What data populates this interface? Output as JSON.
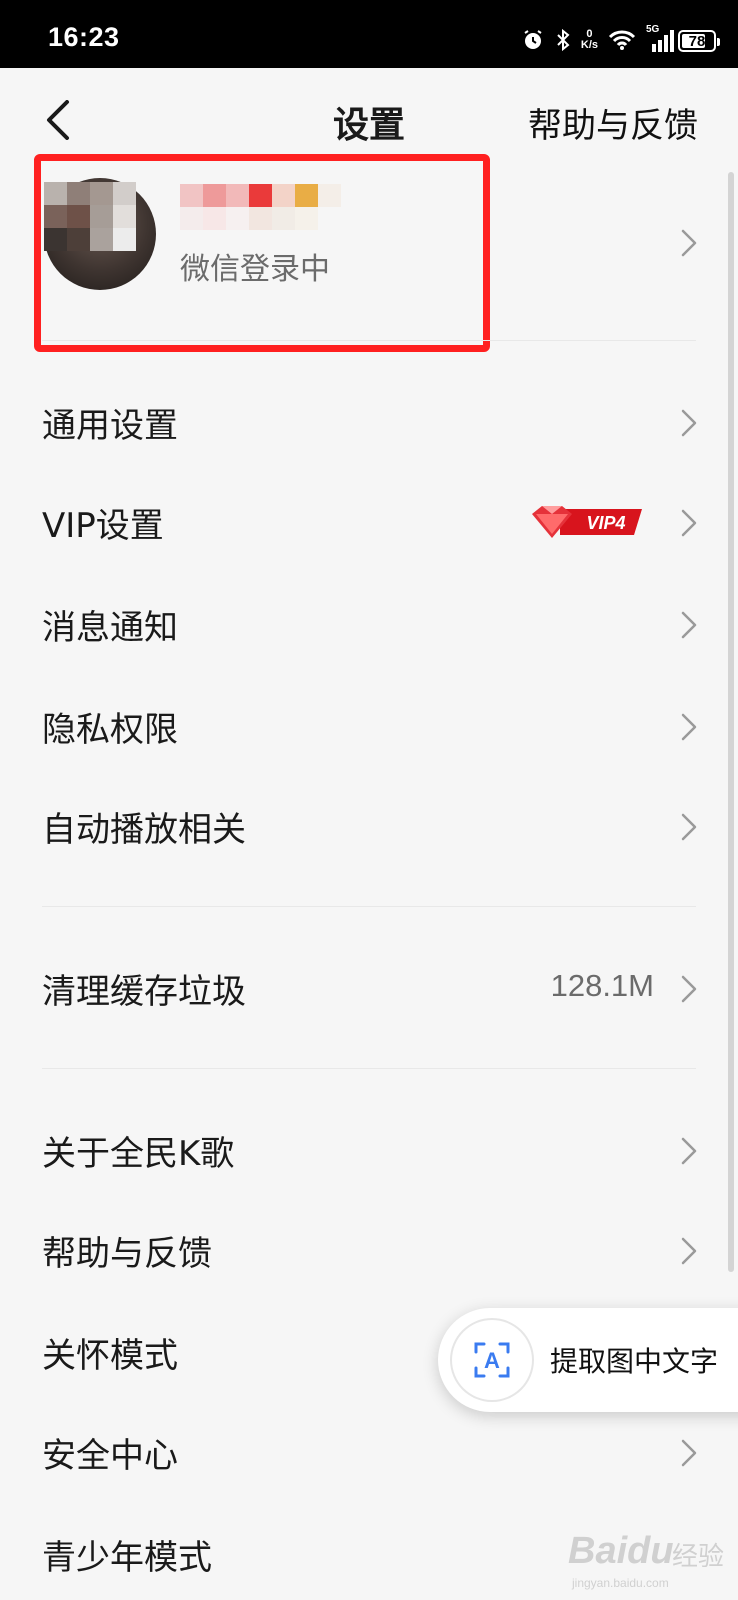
{
  "status_bar": {
    "time": "16:23",
    "net_speed_value": "0",
    "net_speed_unit": "K/s",
    "network_type": "5G",
    "battery": "78",
    "battery_level": 0.78,
    "icons": [
      "alarm-icon",
      "bluetooth-icon",
      "wifi-icon",
      "cellular-signal-icon",
      "battery-icon"
    ]
  },
  "header": {
    "title": "设置",
    "right_action": "帮助与反馈",
    "back_icon": "chevron-left-icon"
  },
  "profile": {
    "subtitle": "微信登录中",
    "highlight_color": "#ff2020"
  },
  "groups": [
    {
      "items": [
        {
          "label": "通用设置"
        },
        {
          "label": "VIP设置",
          "badge": "VIP4",
          "badge_color": "#d8141d"
        },
        {
          "label": "消息通知"
        },
        {
          "label": "隐私权限"
        },
        {
          "label": "自动播放相关"
        }
      ]
    },
    {
      "items": [
        {
          "label": "清理缓存垃圾",
          "value": "128.1M"
        }
      ]
    },
    {
      "items": [
        {
          "label": "关于全民K歌"
        },
        {
          "label": "帮助与反馈"
        },
        {
          "label": "关怀模式"
        },
        {
          "label": "安全中心"
        },
        {
          "label": "青少年模式"
        }
      ]
    }
  ],
  "floating_button": {
    "label": "提取图中文字",
    "icon_letter": "A",
    "accent": "#3a7bf0"
  },
  "watermark": {
    "brand": "Baidu",
    "cn": "经验",
    "url": "jingyan.baidu.com"
  }
}
